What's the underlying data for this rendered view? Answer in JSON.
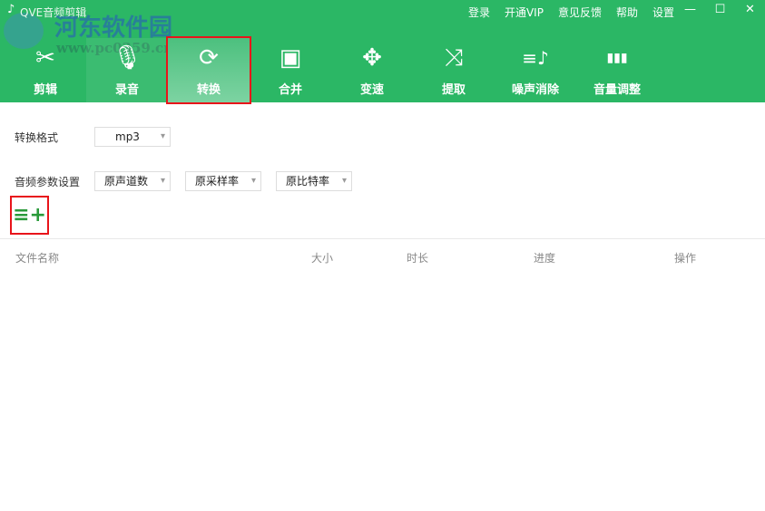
{
  "app": {
    "title": "QVE音频剪辑",
    "watermark": "河东软件园",
    "watermark_url": "www.pc0359.cn"
  },
  "header_links": [
    "登录",
    "开通VIP",
    "意见反馈",
    "帮助",
    "设置"
  ],
  "window_controls": [
    "—",
    "☐",
    "✕"
  ],
  "tabs": [
    {
      "label": "剪辑",
      "icon": "✂"
    },
    {
      "label": "录音",
      "icon": "🎙"
    },
    {
      "label": "转换",
      "icon": "⟳"
    },
    {
      "label": "合并",
      "icon": "▣"
    },
    {
      "label": "变速",
      "icon": "✥"
    },
    {
      "label": "提取",
      "icon": "⤨"
    },
    {
      "label": "噪声消除",
      "icon": "≡♪"
    },
    {
      "label": "音量调整",
      "icon": "▮▮▮"
    }
  ],
  "form": {
    "format_label": "转换格式",
    "format_value": "mp3",
    "params_label": "音频参数设置",
    "channels": "原声道数",
    "sample_rate": "原采样率",
    "bitrate": "原比特率"
  },
  "add_icon": "≡+",
  "table": {
    "headers": [
      "文件名称",
      "大小",
      "时长",
      "进度",
      "操作"
    ]
  }
}
